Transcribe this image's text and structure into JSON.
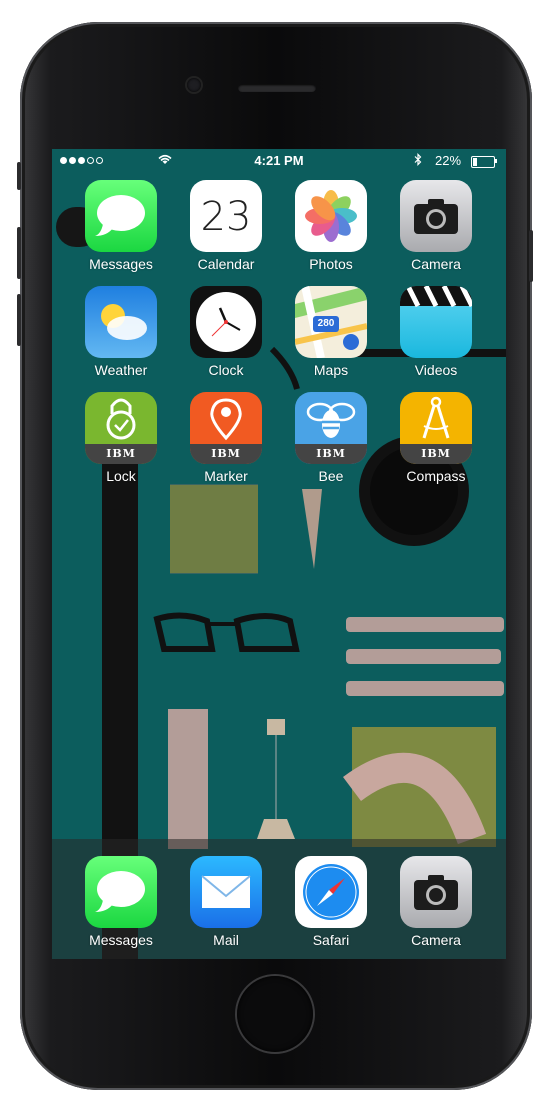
{
  "status_bar": {
    "signal_dots": [
      true,
      true,
      true,
      false,
      false
    ],
    "time": "4:21 PM",
    "battery_percent": "22%",
    "battery_level": 0.22
  },
  "home_screen": {
    "rows": [
      [
        {
          "label": "Messages",
          "icon": "messages-icon"
        },
        {
          "label": "Calendar",
          "icon": "calendar-icon",
          "date": "23"
        },
        {
          "label": "Photos",
          "icon": "photos-icon"
        },
        {
          "label": "Camera",
          "icon": "camera-icon"
        }
      ],
      [
        {
          "label": "Weather",
          "icon": "weather-icon"
        },
        {
          "label": "Clock",
          "icon": "clock-icon"
        },
        {
          "label": "Maps",
          "icon": "maps-icon",
          "badge": "280"
        },
        {
          "label": "Videos",
          "icon": "videos-icon"
        }
      ],
      [
        {
          "label": "Lock",
          "icon": "lock-icon",
          "brand": "IBM"
        },
        {
          "label": "Marker",
          "icon": "marker-icon",
          "brand": "IBM"
        },
        {
          "label": "Bee",
          "icon": "bee-icon",
          "brand": "IBM"
        },
        {
          "label": "Compass",
          "icon": "compass-icon",
          "brand": "IBM"
        }
      ]
    ]
  },
  "dock": [
    {
      "label": "Messages",
      "icon": "messages-icon"
    },
    {
      "label": "Mail",
      "icon": "mail-icon"
    },
    {
      "label": "Safari",
      "icon": "safari-icon"
    },
    {
      "label": "Camera",
      "icon": "camera-icon"
    }
  ],
  "colors": {
    "wallpaper": "#0c5d5d",
    "messages": "#4cd964",
    "lock": "#7ab72f",
    "marker": "#f15a22",
    "bee": "#4aa3e6",
    "compass": "#f4b400"
  }
}
